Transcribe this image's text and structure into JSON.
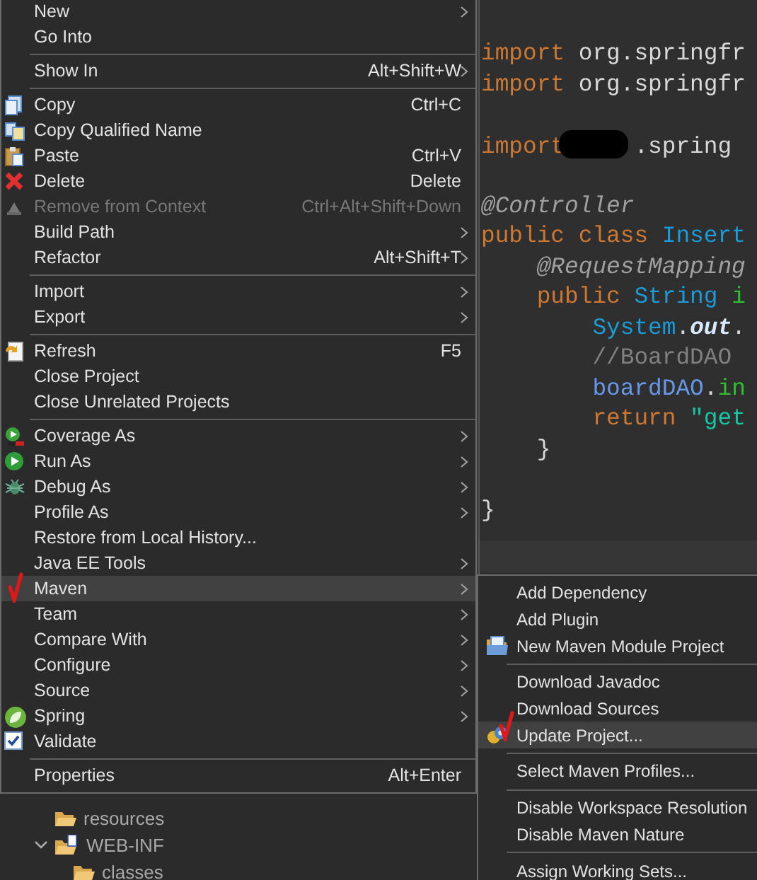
{
  "editor": {
    "lines": [
      {
        "kind": "code",
        "tokens": [
          {
            "kind": "keyword",
            "text": "import"
          },
          {
            "kind": "plain",
            "text": " org.springfr"
          }
        ]
      },
      {
        "kind": "code",
        "tokens": [
          {
            "kind": "keyword",
            "text": "import"
          },
          {
            "kind": "plain",
            "text": " org.springfr"
          }
        ]
      },
      {
        "kind": "blank"
      },
      {
        "kind": "code",
        "tokens": [
          {
            "kind": "keyword",
            "text": "import"
          },
          {
            "kind": "redacted"
          },
          {
            "kind": "plain",
            "text": ".spring"
          }
        ]
      },
      {
        "kind": "blank"
      },
      {
        "kind": "code",
        "tokens": [
          {
            "kind": "annotation",
            "text": "@Controller"
          }
        ]
      },
      {
        "kind": "code",
        "tokens": [
          {
            "kind": "keyword",
            "text": "public class"
          },
          {
            "kind": "type",
            "text": " Insert"
          }
        ]
      },
      {
        "kind": "code",
        "tokens": [
          {
            "kind": "annotation",
            "text": "    @RequestMapping"
          }
        ]
      },
      {
        "kind": "code",
        "tokens": [
          {
            "kind": "keyword",
            "text": "    public"
          },
          {
            "kind": "type",
            "text": " String"
          },
          {
            "kind": "method",
            "text": " i"
          }
        ]
      },
      {
        "kind": "code",
        "tokens": [
          {
            "kind": "type",
            "text": "        System"
          },
          {
            "kind": "plain",
            "text": "."
          },
          {
            "kind": "field",
            "text": "out"
          },
          {
            "kind": "plain",
            "text": "."
          }
        ]
      },
      {
        "kind": "code",
        "tokens": [
          {
            "kind": "comment",
            "text": "        //BoardDAO"
          }
        ]
      },
      {
        "kind": "code",
        "tokens": [
          {
            "kind": "variable",
            "text": "        boardDAO"
          },
          {
            "kind": "plain",
            "text": "."
          },
          {
            "kind": "method",
            "text": "in"
          }
        ]
      },
      {
        "kind": "code",
        "tokens": [
          {
            "kind": "keyword",
            "text": "        return"
          },
          {
            "kind": "string",
            "text": " \"get"
          }
        ]
      },
      {
        "kind": "code",
        "tokens": [
          {
            "kind": "plain",
            "text": "    }"
          }
        ]
      },
      {
        "kind": "blank"
      },
      {
        "kind": "code",
        "tokens": [
          {
            "kind": "plain",
            "text": "}"
          }
        ]
      }
    ]
  },
  "explorer": {
    "tree": [
      {
        "label": "resources"
      },
      {
        "label": "WEB-INF",
        "expanded": true,
        "children": [
          {
            "label": "classes"
          }
        ]
      }
    ]
  },
  "context_menu": {
    "items": [
      {
        "kind": "item",
        "label": "New",
        "has_submenu": true,
        "disabled": false,
        "selected": false,
        "marked": false
      },
      {
        "kind": "item",
        "label": "Go Into",
        "has_submenu": false,
        "disabled": false,
        "selected": false,
        "marked": false
      },
      {
        "kind": "separator"
      },
      {
        "kind": "item",
        "label": "Show In",
        "shortcut": "Alt+Shift+W",
        "has_submenu": true,
        "disabled": false,
        "selected": false,
        "marked": false
      },
      {
        "kind": "separator"
      },
      {
        "kind": "item",
        "label": "Copy",
        "shortcut": "Ctrl+C",
        "has_submenu": false,
        "disabled": false,
        "selected": false,
        "marked": false
      },
      {
        "kind": "item",
        "label": "Copy Qualified Name",
        "has_submenu": false,
        "disabled": false,
        "selected": false,
        "marked": false
      },
      {
        "kind": "item",
        "label": "Paste",
        "shortcut": "Ctrl+V",
        "has_submenu": false,
        "disabled": false,
        "selected": false,
        "marked": false
      },
      {
        "kind": "item",
        "label": "Delete",
        "shortcut": "Delete",
        "has_submenu": false,
        "disabled": false,
        "selected": false,
        "marked": false
      },
      {
        "kind": "item",
        "label": "Remove from Context",
        "shortcut": "Ctrl+Alt+Shift+Down",
        "has_submenu": false,
        "disabled": true,
        "selected": false,
        "marked": false
      },
      {
        "kind": "item",
        "label": "Build Path",
        "has_submenu": true,
        "disabled": false,
        "selected": false,
        "marked": false
      },
      {
        "kind": "item",
        "label": "Refactor",
        "shortcut": "Alt+Shift+T",
        "has_submenu": true,
        "disabled": false,
        "selected": false,
        "marked": false
      },
      {
        "kind": "separator"
      },
      {
        "kind": "item",
        "label": "Import",
        "has_submenu": true,
        "disabled": false,
        "selected": false,
        "marked": false
      },
      {
        "kind": "item",
        "label": "Export",
        "has_submenu": true,
        "disabled": false,
        "selected": false,
        "marked": false
      },
      {
        "kind": "separator"
      },
      {
        "kind": "item",
        "label": "Refresh",
        "shortcut": "F5",
        "has_submenu": false,
        "disabled": false,
        "selected": false,
        "marked": false
      },
      {
        "kind": "item",
        "label": "Close Project",
        "has_submenu": false,
        "disabled": false,
        "selected": false,
        "marked": false
      },
      {
        "kind": "item",
        "label": "Close Unrelated Projects",
        "has_submenu": false,
        "disabled": false,
        "selected": false,
        "marked": false
      },
      {
        "kind": "separator"
      },
      {
        "kind": "item",
        "label": "Coverage As",
        "has_submenu": true,
        "disabled": false,
        "selected": false,
        "marked": false
      },
      {
        "kind": "item",
        "label": "Run As",
        "has_submenu": true,
        "disabled": false,
        "selected": false,
        "marked": false
      },
      {
        "kind": "item",
        "label": "Debug As",
        "has_submenu": true,
        "disabled": false,
        "selected": false,
        "marked": false
      },
      {
        "kind": "item",
        "label": "Profile As",
        "has_submenu": true,
        "disabled": false,
        "selected": false,
        "marked": false
      },
      {
        "kind": "item",
        "label": "Restore from Local History...",
        "has_submenu": false,
        "disabled": false,
        "selected": false,
        "marked": false
      },
      {
        "kind": "item",
        "label": "Java EE Tools",
        "has_submenu": true,
        "disabled": false,
        "selected": false,
        "marked": false
      },
      {
        "kind": "item",
        "label": "Maven",
        "has_submenu": true,
        "disabled": false,
        "selected": true,
        "marked": true
      },
      {
        "kind": "item",
        "label": "Team",
        "has_submenu": true,
        "disabled": false,
        "selected": false,
        "marked": false
      },
      {
        "kind": "item",
        "label": "Compare With",
        "has_submenu": true,
        "disabled": false,
        "selected": false,
        "marked": false
      },
      {
        "kind": "item",
        "label": "Configure",
        "has_submenu": true,
        "disabled": false,
        "selected": false,
        "marked": false
      },
      {
        "kind": "item",
        "label": "Source",
        "has_submenu": true,
        "disabled": false,
        "selected": false,
        "marked": false
      },
      {
        "kind": "item",
        "label": "Spring",
        "has_submenu": true,
        "disabled": false,
        "selected": false,
        "marked": false
      },
      {
        "kind": "item",
        "label": "Validate",
        "has_submenu": false,
        "disabled": false,
        "selected": false,
        "marked": false
      },
      {
        "kind": "separator"
      },
      {
        "kind": "item",
        "label": "Properties",
        "shortcut": "Alt+Enter",
        "has_submenu": false,
        "disabled": false,
        "selected": false,
        "marked": false
      }
    ]
  },
  "submenu": {
    "items": [
      {
        "kind": "item",
        "label": "Add Dependency",
        "disabled": false,
        "selected": false,
        "marked": false
      },
      {
        "kind": "item",
        "label": "Add Plugin",
        "disabled": false,
        "selected": false,
        "marked": false
      },
      {
        "kind": "item",
        "label": "New Maven Module Project",
        "disabled": false,
        "selected": false,
        "marked": false
      },
      {
        "kind": "separator"
      },
      {
        "kind": "item",
        "label": "Download Javadoc",
        "disabled": false,
        "selected": false,
        "marked": false
      },
      {
        "kind": "item",
        "label": "Download Sources",
        "disabled": false,
        "selected": false,
        "marked": false
      },
      {
        "kind": "item",
        "label": "Update Project...",
        "disabled": false,
        "selected": true,
        "marked": true
      },
      {
        "kind": "separator"
      },
      {
        "kind": "item",
        "label": "Select Maven Profiles...",
        "disabled": false,
        "selected": false,
        "marked": false
      },
      {
        "kind": "separator"
      },
      {
        "kind": "item",
        "label": "Disable Workspace Resolution",
        "disabled": false,
        "selected": false,
        "marked": false
      },
      {
        "kind": "item",
        "label": "Disable Maven Nature",
        "disabled": false,
        "selected": false,
        "marked": false
      },
      {
        "kind": "separator"
      },
      {
        "kind": "item",
        "label": "Assign Working Sets...",
        "disabled": false,
        "selected": false,
        "marked": false
      }
    ]
  }
}
